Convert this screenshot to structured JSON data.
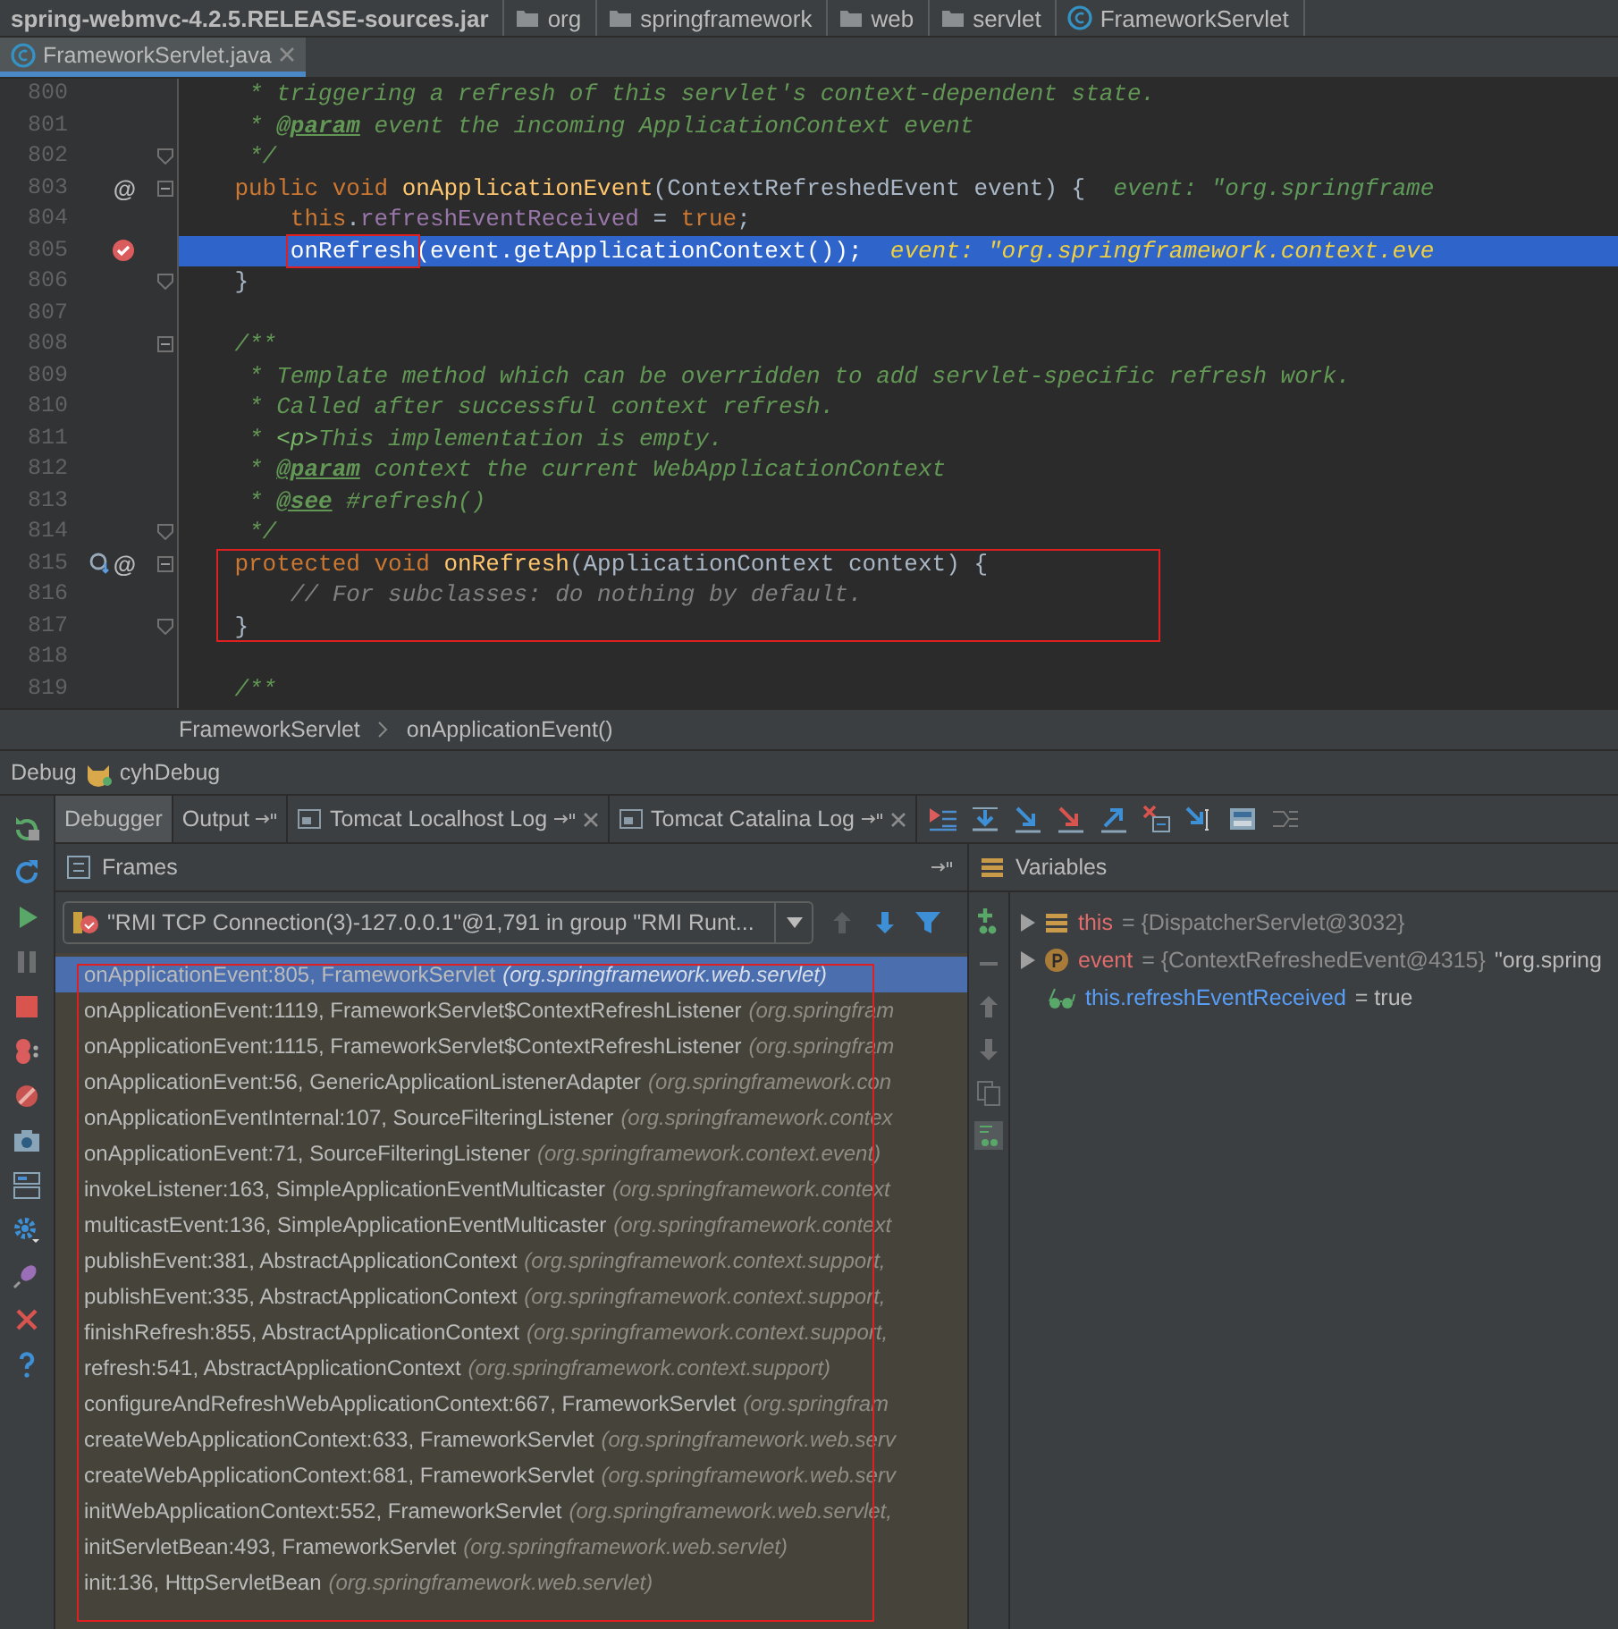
{
  "breadcrumbs": [
    {
      "kind": "jar",
      "label": "spring-webmvc-4.2.5.RELEASE-sources.jar"
    },
    {
      "kind": "package",
      "label": "org"
    },
    {
      "kind": "package",
      "label": "springframework"
    },
    {
      "kind": "package",
      "label": "web"
    },
    {
      "kind": "package",
      "label": "servlet"
    },
    {
      "kind": "class",
      "label": "FrameworkServlet"
    }
  ],
  "editor_tabs": [
    {
      "label": "FrameworkServlet.java",
      "selected": true
    }
  ],
  "code_lines": [
    {
      "number": "800",
      "tokens": [
        {
          "kind": "doc",
          "t": "     * triggering a refresh of this servlet's context-dependent state."
        }
      ]
    },
    {
      "number": "801",
      "tokens": [
        {
          "kind": "doc",
          "t": "     * "
        },
        {
          "kind": "tag",
          "t": "@param"
        },
        {
          "kind": "doc",
          "t": " event the incoming ApplicationContext event"
        }
      ]
    },
    {
      "number": "802",
      "fold_end": true,
      "tokens": [
        {
          "kind": "doc",
          "t": "     */"
        }
      ]
    },
    {
      "number": "803",
      "fold_start": true,
      "gutter": [
        {
          "kind": "override",
          "text": "@"
        }
      ],
      "tokens": [
        {
          "kind": "kw",
          "t": "    public void "
        },
        {
          "kind": "method",
          "t": "onApplicationEvent"
        },
        {
          "kind": "plain",
          "t": "(ContextRefreshedEvent event) {  "
        },
        {
          "kind": "hint",
          "t": "event: \"org.springframe"
        }
      ]
    },
    {
      "number": "804",
      "tokens": [
        {
          "kind": "kw",
          "t": "        this"
        },
        {
          "kind": "plain",
          "t": "."
        },
        {
          "kind": "field",
          "t": "refreshEventReceived"
        },
        {
          "kind": "plain",
          "t": " = "
        },
        {
          "kind": "kw",
          "t": "true"
        },
        {
          "kind": "plain",
          "t": ";"
        }
      ]
    },
    {
      "number": "805",
      "selected": true,
      "gutter": [
        {
          "kind": "breakpoint"
        }
      ],
      "tokens": [
        {
          "kind": "plain",
          "t": "onRefresh",
          "boxed": true
        },
        {
          "kind": "plain",
          "t": "(event.getApplicationContext());  "
        },
        {
          "kind": "hint",
          "t": "event: \"org.springframework.context.eve"
        }
      ]
    },
    {
      "number": "806",
      "fold_end": true,
      "tokens": [
        {
          "kind": "plain",
          "t": "    }"
        }
      ]
    },
    {
      "number": "807"
    },
    {
      "number": "808",
      "fold_start": true,
      "tokens": [
        {
          "kind": "doc",
          "t": "    /**"
        }
      ]
    },
    {
      "number": "809",
      "tokens": [
        {
          "kind": "doc",
          "t": "     * Template method which can be overridden to add servlet-specific refresh work."
        }
      ]
    },
    {
      "number": "810",
      "tokens": [
        {
          "kind": "doc",
          "t": "     * Called after successful context refresh."
        }
      ]
    },
    {
      "number": "811",
      "tokens": [
        {
          "kind": "doc",
          "t": "     * "
        },
        {
          "kind": "html",
          "t": "<p>"
        },
        {
          "kind": "doc",
          "t": "This implementation is empty."
        }
      ]
    },
    {
      "number": "812",
      "tokens": [
        {
          "kind": "doc",
          "t": "     * "
        },
        {
          "kind": "tag",
          "t": "@param"
        },
        {
          "kind": "doc",
          "t": " context the current WebApplicationContext"
        }
      ]
    },
    {
      "number": "813",
      "tokens": [
        {
          "kind": "doc",
          "t": "     * "
        },
        {
          "kind": "tag",
          "t": "@see"
        },
        {
          "kind": "doc",
          "t": " #refresh()"
        }
      ]
    },
    {
      "number": "814",
      "fold_end": true,
      "tokens": [
        {
          "kind": "doc",
          "t": "     */"
        }
      ]
    },
    {
      "number": "815",
      "fold_start": true,
      "boxed": true,
      "gutter": [
        {
          "kind": "overridden"
        },
        {
          "kind": "override",
          "text": "@"
        }
      ],
      "tokens": [
        {
          "kind": "kw",
          "t": "    protected void "
        },
        {
          "kind": "method",
          "t": "onRefresh"
        },
        {
          "kind": "plain",
          "t": "(ApplicationContext context) {"
        }
      ]
    },
    {
      "number": "816",
      "boxed": true,
      "tokens": [
        {
          "kind": "comment",
          "t": "        // For subclasses: do nothing by default."
        }
      ]
    },
    {
      "number": "817",
      "fold_end": true,
      "boxed": true,
      "tokens": [
        {
          "kind": "plain",
          "t": "    }"
        }
      ]
    },
    {
      "number": "818"
    },
    {
      "number": "819",
      "tokens": [
        {
          "kind": "doc",
          "t": "    /**"
        }
      ]
    }
  ],
  "editor_breadcrumbs": [
    "FrameworkServlet",
    "onApplicationEvent()"
  ],
  "debug": {
    "title": "Debug",
    "config": "cyhDebug"
  },
  "tabs": [
    {
      "label": "Debugger",
      "selected": true,
      "pinned": false,
      "closable": false,
      "log": false
    },
    {
      "label": "Output",
      "selected": false,
      "pinned": true,
      "closable": false,
      "log": false
    },
    {
      "label": "Tomcat Localhost Log",
      "selected": false,
      "pinned": true,
      "closable": true,
      "log": true
    },
    {
      "label": "Tomcat Catalina Log",
      "selected": false,
      "pinned": true,
      "closable": true,
      "log": true
    }
  ],
  "frames": {
    "title": "Frames",
    "boxed": true,
    "thread": "\"RMI TCP Connection(3)-127.0.0.1\"@1,791 in group \"RMI Runt...",
    "items": [
      {
        "call": "onApplicationEvent:805, FrameworkServlet",
        "package": "(org.springframework.web.servlet)",
        "selected": true
      },
      {
        "call": "onApplicationEvent:1119, FrameworkServlet$ContextRefreshListener",
        "package": "(org.springfram",
        "selected": false
      },
      {
        "call": "onApplicationEvent:1115, FrameworkServlet$ContextRefreshListener",
        "package": "(org.springfram",
        "selected": false
      },
      {
        "call": "onApplicationEvent:56, GenericApplicationListenerAdapter",
        "package": "(org.springframework.con",
        "selected": false
      },
      {
        "call": "onApplicationEventInternal:107, SourceFilteringListener",
        "package": "(org.springframework.contex",
        "selected": false
      },
      {
        "call": "onApplicationEvent:71, SourceFilteringListener",
        "package": "(org.springframework.context.event)",
        "selected": false
      },
      {
        "call": "invokeListener:163, SimpleApplicationEventMulticaster",
        "package": "(org.springframework.context",
        "selected": false
      },
      {
        "call": "multicastEvent:136, SimpleApplicationEventMulticaster",
        "package": "(org.springframework.context",
        "selected": false
      },
      {
        "call": "publishEvent:381, AbstractApplicationContext",
        "package": "(org.springframework.context.support,",
        "selected": false
      },
      {
        "call": "publishEvent:335, AbstractApplicationContext",
        "package": "(org.springframework.context.support,",
        "selected": false
      },
      {
        "call": "finishRefresh:855, AbstractApplicationContext",
        "package": "(org.springframework.context.support,",
        "selected": false
      },
      {
        "call": "refresh:541, AbstractApplicationContext",
        "package": "(org.springframework.context.support)",
        "selected": false
      },
      {
        "call": "configureAndRefreshWebApplicationContext:667, FrameworkServlet",
        "package": "(org.springfram",
        "selected": false
      },
      {
        "call": "createWebApplicationContext:633, FrameworkServlet",
        "package": "(org.springframework.web.serv",
        "selected": false
      },
      {
        "call": "createWebApplicationContext:681, FrameworkServlet",
        "package": "(org.springframework.web.serv",
        "selected": false
      },
      {
        "call": "initWebApplicationContext:552, FrameworkServlet",
        "package": "(org.springframework.web.servlet,",
        "selected": false
      },
      {
        "call": "initServletBean:493, FrameworkServlet",
        "package": "(org.springframework.web.servlet)",
        "selected": false
      },
      {
        "call": "init:136, HttpServletBean",
        "package": "(org.springframework.web.servlet)",
        "selected": false
      }
    ]
  },
  "variables": {
    "title": "Variables",
    "items": [
      {
        "kind": "field",
        "expandable": true,
        "name": "this",
        "value": "= {DispatcherServlet@3032}"
      },
      {
        "kind": "param",
        "expandable": true,
        "name": "event",
        "value": "= {ContextRefreshedEvent@4315}",
        "preview": "\"org.spring"
      },
      {
        "kind": "watch",
        "expandable": false,
        "name": "this.refreshEventReceived",
        "value": "= true"
      }
    ]
  }
}
